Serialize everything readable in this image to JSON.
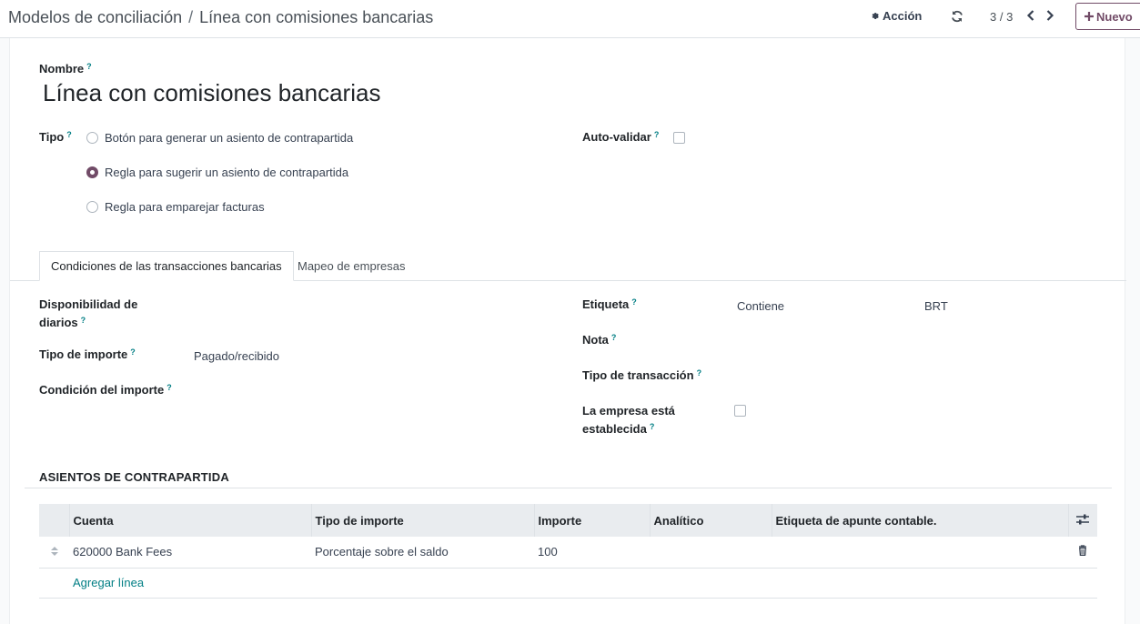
{
  "breadcrumb": {
    "parent": "Modelos de conciliación",
    "separator": "/",
    "current": "Línea con comisiones bancarias"
  },
  "toolbar": {
    "action_label": "Acción",
    "pager": "3 / 3",
    "new_label": "Nuevo"
  },
  "form": {
    "name_label": "Nombre",
    "name_value": "Línea con comisiones bancarias",
    "help_mark": "?",
    "tipo_label": "Tipo",
    "tipo_options": [
      {
        "label": "Botón para generar un asiento de contrapartida",
        "selected": false
      },
      {
        "label": "Regla para sugerir un asiento de contrapartida",
        "selected": true
      },
      {
        "label": "Regla para emparejar facturas",
        "selected": false
      }
    ],
    "auto_validate_label": "Auto-validar",
    "auto_validate_checked": false
  },
  "tabs": [
    {
      "label": "Condiciones de las transacciones bancarias",
      "active": true
    },
    {
      "label": "Mapeo de empresas",
      "active": false
    }
  ],
  "conditions": {
    "journal_label_line1": "Disponibilidad de",
    "journal_label_line2": "diarios",
    "amount_type_label": "Tipo de importe",
    "amount_type_value": "Pagado/recibido",
    "amount_condition_label": "Condición del importe",
    "etiqueta_label": "Etiqueta",
    "etiqueta_operator": "Contiene",
    "etiqueta_value": "BRT",
    "nota_label": "Nota",
    "transaction_type_label": "Tipo de transacción",
    "partner_set_label_line1": "La empresa está",
    "partner_set_label_line2": "establecida",
    "partner_set_checked": false
  },
  "counterpart": {
    "section_title": "ASIENTOS DE CONTRAPARTIDA",
    "columns": [
      "Cuenta",
      "Tipo de importe",
      "Importe",
      "Analítico",
      "Etiqueta de apunte contable."
    ],
    "rows": [
      {
        "account": "620000 Bank Fees",
        "amount_type": "Porcentaje sobre el saldo",
        "amount": "100",
        "analytic": "",
        "label": ""
      }
    ],
    "add_line_label": "Agregar línea"
  },
  "colors": {
    "accent": "#714b67",
    "link": "#017e84"
  }
}
